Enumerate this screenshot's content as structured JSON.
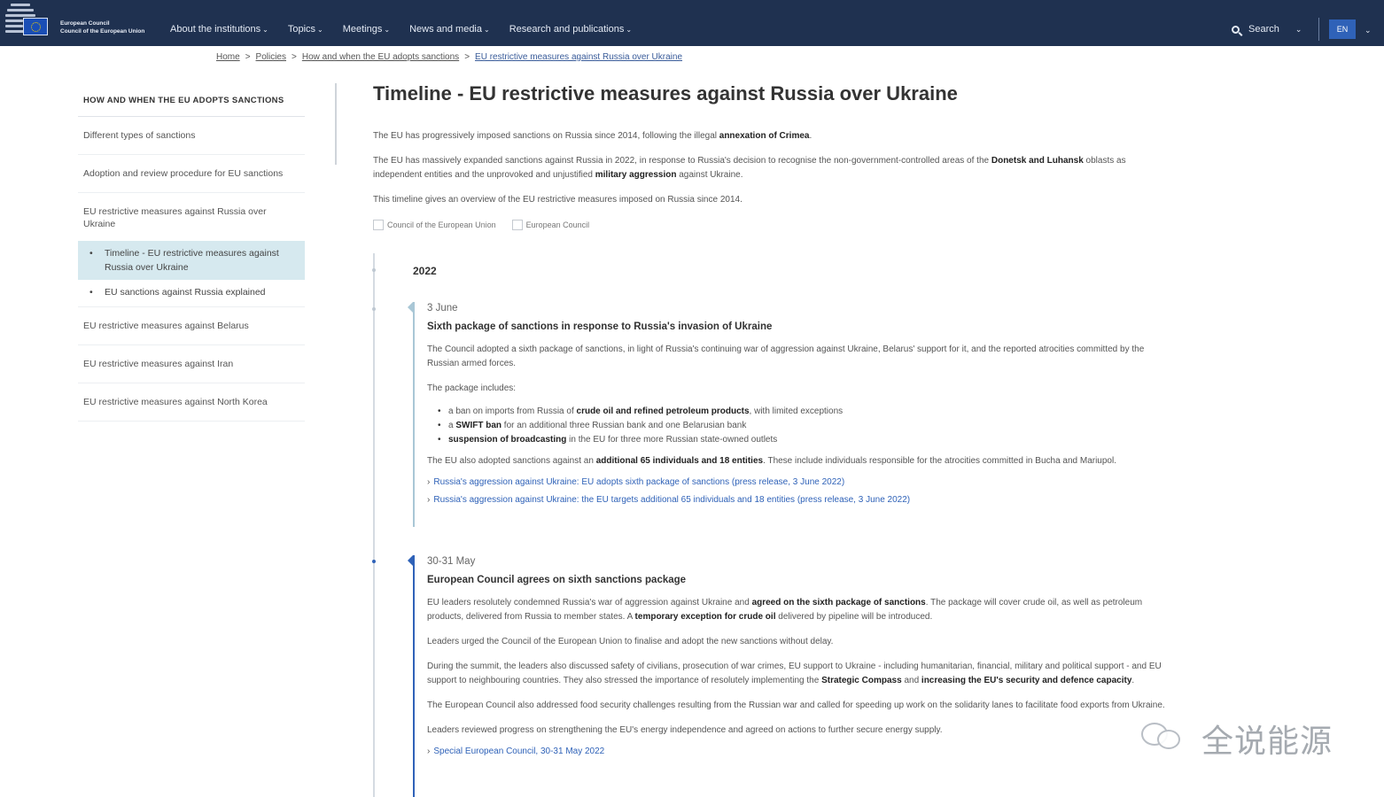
{
  "header": {
    "brand_line1": "European Council",
    "brand_line2": "Council of the European Union",
    "menu": [
      {
        "label": "About the institutions"
      },
      {
        "label": "Topics"
      },
      {
        "label": "Meetings"
      },
      {
        "label": "News and media"
      },
      {
        "label": "Research and publications"
      }
    ],
    "search_label": "Search",
    "language": "EN",
    "colors": {
      "nav_bg": "#1f3150",
      "lang_bg": "#2f62b8"
    }
  },
  "breadcrumb": {
    "items": [
      "Home",
      "Policies",
      "How and when the EU adopts sanctions",
      "EU restrictive measures against Russia over Ukraine"
    ],
    "separator": ">"
  },
  "sidebar": {
    "heading": "HOW AND WHEN THE EU ADOPTS SANCTIONS",
    "items": [
      "Different types of sanctions",
      "Adoption and review procedure for EU sanctions",
      "EU restrictive measures against Russia over Ukraine"
    ],
    "subitems": [
      "Timeline - EU restrictive measures against Russia over Ukraine",
      "EU sanctions against Russia explained"
    ],
    "items_after": [
      "EU restrictive measures against Belarus",
      "EU restrictive measures against Iran",
      "EU restrictive measures against North Korea"
    ]
  },
  "main": {
    "title": "Timeline - EU restrictive measures against Russia over Ukraine",
    "intro1_a": "The EU has progressively imposed sanctions on Russia since 2014, following the illegal ",
    "intro1_b": "annexation of Crimea",
    "intro1_c": ".",
    "intro2_a": "The EU has massively expanded sanctions against Russia in 2022, in response to Russia's decision to recognise the non-government-controlled areas of the ",
    "intro2_b": "Donetsk and Luhansk",
    "intro2_c": " oblasts as independent entities and the unprovoked and unjustified ",
    "intro2_d": "military aggression",
    "intro2_e": " against Ukraine.",
    "intro3": "This timeline gives an overview of the EU restrictive measures imposed on Russia since 2014.",
    "filters": [
      "Council of the European Union",
      "European Council"
    ]
  },
  "timeline": {
    "year": "2022",
    "entry1": {
      "date": "3 June",
      "title": "Sixth package of sanctions in response to Russia's invasion of Ukraine",
      "p1": "The Council adopted a sixth package of sanctions, in light of Russia's continuing war of aggression against Ukraine, Belarus' support for it, and the reported atrocities committed by the Russian armed forces.",
      "p2": "The package includes:",
      "b1_a": "a ban on imports from Russia of ",
      "b1_b": "crude oil and refined petroleum products",
      "b1_c": ", with limited exceptions",
      "b2_a": "a ",
      "b2_b": "SWIFT ban",
      "b2_c": " for an additional three Russian bank and one Belarusian bank",
      "b3_a": "suspension of broadcasting",
      "b3_b": " in the EU for three more Russian state-owned outlets",
      "p3_a": "The EU also adopted sanctions against an ",
      "p3_b": "additional 65 individuals and 18 entities",
      "p3_c": ". These include individuals responsible for the atrocities committed in Bucha and Mariupol.",
      "link1": "Russia's aggression against Ukraine: EU adopts sixth package of sanctions (press release, 3 June 2022)",
      "link2": "Russia's aggression against Ukraine: the EU targets additional 65 individuals and 18 entities (press release, 3 June 2022)"
    },
    "entry2": {
      "date": "30-31 May",
      "title": "European Council agrees on sixth sanctions package",
      "p1_a": "EU leaders resolutely condemned Russia's war of aggression against Ukraine and ",
      "p1_b": "agreed on the sixth package of sanctions",
      "p1_c": ". The package will cover crude oil, as well as petroleum products, delivered from Russia to member states. A ",
      "p1_d": "temporary exception for crude oil",
      "p1_e": " delivered by pipeline will be introduced.",
      "p2": "Leaders urged the Council of the European Union to finalise and adopt the new sanctions without delay.",
      "p3_a": "During the summit, the leaders also discussed safety of civilians, prosecution of war crimes, EU support to Ukraine - including humanitarian, financial, military and political support - and EU support to neighbouring countries. They also stressed the importance of resolutely implementing the ",
      "p3_b": "Strategic Compass",
      "p3_c": " and ",
      "p3_d": "increasing the EU's security and defence capacity",
      "p3_e": ".",
      "p4": "The European Council also addressed food security challenges resulting from the Russian war and called for speeding up work on the solidarity lanes to facilitate food exports from Ukraine.",
      "p5": "Leaders reviewed progress on strengthening the EU's energy independence and agreed on actions to further secure energy supply.",
      "link1": "Special European Council, 30-31 May 2022"
    },
    "colors": {
      "entry1_bar": "#a9c7d6",
      "entry2_bar": "#2f62b8"
    }
  },
  "watermark": {
    "text": "全说能源"
  }
}
